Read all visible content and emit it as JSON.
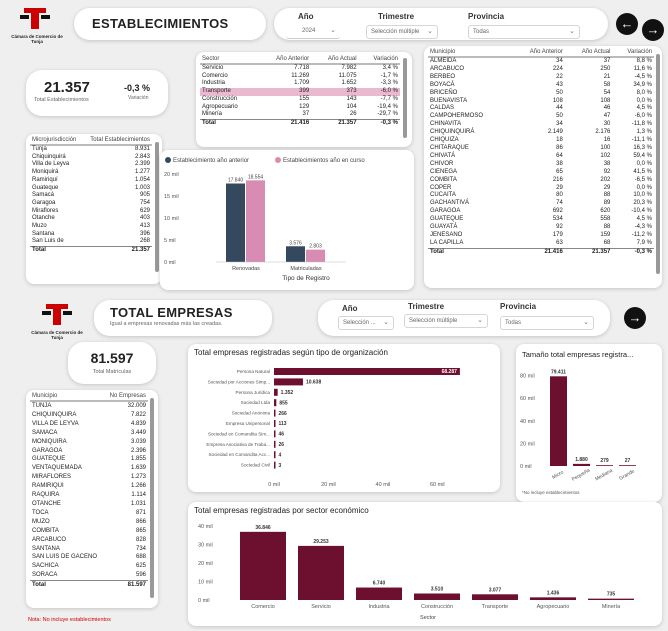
{
  "top": {
    "org_name": "Cámara de Comercio de Tunja",
    "title": "ESTABLECIMIENTOS",
    "filters": {
      "year_label": "Año",
      "year_value": "2024",
      "quarter_label": "Trimestre",
      "quarter_value": "Selección múltiple",
      "province_label": "Provincia",
      "province_value": "Todas"
    },
    "kpi": {
      "value": "21.357",
      "label": "Total Establecimientos",
      "variation": "-0,3 %",
      "variation_label": "Variación"
    },
    "sector_table": {
      "headers": [
        "Sector",
        "Año Anterior",
        "Año Actual",
        "Variación"
      ],
      "rows": [
        [
          "Servicio",
          "7.718",
          "7.982",
          "3,4 %"
        ],
        [
          "Comercio",
          "11.269",
          "11.075",
          "-1,7 %"
        ],
        [
          "Industria",
          "1.709",
          "1.652",
          "-3,3 %"
        ],
        [
          "Transporte",
          "399",
          "373",
          "-6,0 %"
        ],
        [
          "Construcción",
          "155",
          "143",
          "-7,7 %"
        ],
        [
          "Agropecuario",
          "129",
          "104",
          "-19,4 %"
        ],
        [
          "Minería",
          "37",
          "26",
          "-29,7 %"
        ]
      ],
      "total": [
        "Total",
        "21.416",
        "21.357",
        "-0,3 %"
      ]
    },
    "micro_table": {
      "headers": [
        "Microjurisdicción",
        "Total Establecimientos"
      ],
      "rows": [
        [
          "Tunja",
          "8.931"
        ],
        [
          "Chiquinquirá",
          "2.843"
        ],
        [
          "Villa de Leyva",
          "2.399"
        ],
        [
          "Moniquirá",
          "1.277"
        ],
        [
          "Ramiriquí",
          "1.054"
        ],
        [
          "Guateque",
          "1.003"
        ],
        [
          "Samacá",
          "905"
        ],
        [
          "Garagoa",
          "754"
        ],
        [
          "Miraflores",
          "629"
        ],
        [
          "Otanche",
          "403"
        ],
        [
          "Muzo",
          "413"
        ],
        [
          "Santana",
          "396"
        ],
        [
          "San Luis de",
          "268"
        ]
      ],
      "total": [
        "Total",
        "21.357"
      ]
    },
    "muni_table": {
      "headers": [
        "Municipio",
        "Año Anterior",
        "Año Actual",
        "Variación"
      ],
      "rows": [
        [
          "ALMEIDA",
          "34",
          "37",
          "8,8 %"
        ],
        [
          "ARCABUCO",
          "224",
          "250",
          "11,6 %"
        ],
        [
          "BERBEO",
          "22",
          "21",
          "-4,5 %"
        ],
        [
          "BOYACÁ",
          "43",
          "58",
          "34,9 %"
        ],
        [
          "BRICEÑO",
          "50",
          "54",
          "8,0 %"
        ],
        [
          "BUENAVISTA",
          "108",
          "108",
          "0,0 %"
        ],
        [
          "CALDAS",
          "44",
          "46",
          "4,5 %"
        ],
        [
          "CAMPOHERMOSO",
          "50",
          "47",
          "-6,0 %"
        ],
        [
          "CHINAVITA",
          "34",
          "30",
          "-11,8 %"
        ],
        [
          "CHIQUINQUIRÁ",
          "2.149",
          "2.176",
          "1,3 %"
        ],
        [
          "CHIQUIZA",
          "18",
          "16",
          "-11,1 %"
        ],
        [
          "CHITARAQUE",
          "86",
          "100",
          "16,3 %"
        ],
        [
          "CHIVATÁ",
          "64",
          "102",
          "59,4 %"
        ],
        [
          "CHIVOR",
          "38",
          "38",
          "0,0 %"
        ],
        [
          "CIENEGA",
          "65",
          "92",
          "41,5 %"
        ],
        [
          "COMBITA",
          "216",
          "202",
          "-6,5 %"
        ],
        [
          "COPER",
          "29",
          "29",
          "0,0 %"
        ],
        [
          "CUCAITA",
          "80",
          "88",
          "10,0 %"
        ],
        [
          "GACHANTIVÁ",
          "74",
          "89",
          "20,3 %"
        ],
        [
          "GARAGOA",
          "692",
          "620",
          "-10,4 %"
        ],
        [
          "GUATEQUE",
          "534",
          "558",
          "4,5 %"
        ],
        [
          "GUAYATÁ",
          "92",
          "88",
          "-4,3 %"
        ],
        [
          "JENESANO",
          "179",
          "159",
          "-11,2 %"
        ],
        [
          "LA CAPILLA",
          "63",
          "68",
          "7,9 %"
        ]
      ],
      "total": [
        "Total",
        "21.416",
        "21.357",
        "-0,3 %"
      ]
    },
    "reg_chart": {
      "legend_prev": "Establecimiento año anterior",
      "legend_curr": "Establecimientos año en curso",
      "xlabel": "Tipo de Registro",
      "color_prev": "#34495e",
      "color_curr": "#d98cb3"
    }
  },
  "chart_data": [
    {
      "type": "bar",
      "title": "",
      "xlabel": "Tipo de Registro",
      "ylabel": "",
      "categories": [
        "Renovadas",
        "Matriculadas"
      ],
      "series": [
        {
          "name": "Establecimiento año anterior",
          "values": [
            17840,
            3576
          ]
        },
        {
          "name": "Establecimientos año en curso",
          "values": [
            18554,
            2803
          ]
        }
      ],
      "yticks": [
        "0 mil",
        "5 mil",
        "10 mil",
        "15 mil",
        "20 mil"
      ],
      "ylim": [
        0,
        20000
      ]
    },
    {
      "type": "bar",
      "title": "Total empresas registradas según tipo de organización",
      "orientation": "horizontal",
      "categories": [
        "Persona Natural",
        "Sociedad por Acciones Simp...",
        "Persona Jurídica",
        "Sociedad Ltda",
        "Sociedad Anónima",
        "Empresa Unipersonal",
        "Sociedad en Comandita Sim...",
        "Empresa Asociativa de Traba...",
        "Sociedad en Comandita Acc...",
        "Sociedad Civil"
      ],
      "values": [
        68287,
        10638,
        1352,
        855,
        266,
        113,
        46,
        26,
        4,
        3
      ],
      "value_labels": [
        "68.287",
        "10.638",
        "1.352",
        "855",
        "266",
        "113",
        "46",
        "26",
        "4",
        "3"
      ],
      "xticks": [
        "0 mil",
        "20 mil",
        "40 mil",
        "60 mil"
      ],
      "xlim": [
        0,
        72000
      ]
    },
    {
      "type": "bar",
      "title": "Tamaño total empresas registra...",
      "categories": [
        "Micro",
        "Pequeña",
        "Mediana",
        "Grande"
      ],
      "values": [
        79411,
        1880,
        279,
        27
      ],
      "value_labels": [
        "79.411",
        "1.880",
        "279",
        "27"
      ],
      "yticks": [
        "0 mil",
        "20 mil",
        "40 mil",
        "60 mil",
        "80 mil"
      ],
      "ylim": [
        0,
        85000
      ],
      "note": "*No incluye establecimientos"
    },
    {
      "type": "bar",
      "title": "Total empresas registradas por sector económico",
      "xlabel": "Sector",
      "categories": [
        "Comercio",
        "Servicio",
        "Industria",
        "Construcción",
        "Transporte",
        "Agropecuario",
        "Minería"
      ],
      "values": [
        36846,
        29253,
        6740,
        3510,
        3077,
        1436,
        735
      ],
      "value_labels": [
        "36.846",
        "29.253",
        "6.740",
        "3.510",
        "3.077",
        "1.436",
        "735"
      ],
      "yticks": [
        "0 mil",
        "10 mil",
        "20 mil",
        "30 mil",
        "40 mil"
      ],
      "ylim": [
        0,
        40000
      ]
    }
  ],
  "bottom": {
    "org_name": "Cámara de Comercio de Tunja",
    "title": "TOTAL EMPRESAS",
    "subtitle": "Igual a empresas renovadas más las creadas.",
    "filters": {
      "year_label": "Año",
      "year_value": "Selección ...",
      "quarter_label": "Trimestre",
      "quarter_value": "Selección múltiple",
      "province_label": "Provincia",
      "province_value": "Todas"
    },
    "kpi": {
      "value": "81.597",
      "label": "Total Matrículas"
    },
    "muni_table": {
      "headers": [
        "Municipio",
        "No Empresas"
      ],
      "rows": [
        [
          "TUNJA",
          "32.009"
        ],
        [
          "CHIQUINQUIRA",
          "7.822"
        ],
        [
          "VILLA DE LEYVA",
          "4.839"
        ],
        [
          "SAMACA",
          "3.449"
        ],
        [
          "MONIQUIRA",
          "3.039"
        ],
        [
          "GARAGOA",
          "2.396"
        ],
        [
          "GUATEQUE",
          "1.855"
        ],
        [
          "VENTAQUEMADA",
          "1.639"
        ],
        [
          "MIRAFLORES",
          "1.273"
        ],
        [
          "RAMIRIQUI",
          "1.266"
        ],
        [
          "RAQUIRA",
          "1.114"
        ],
        [
          "OTANCHE",
          "1.031"
        ],
        [
          "TOCA",
          "871"
        ],
        [
          "MUZO",
          "866"
        ],
        [
          "COMBITA",
          "865"
        ],
        [
          "ARCABUCO",
          "828"
        ],
        [
          "SANTANA",
          "734"
        ],
        [
          "SAN LUIS DE GACENO",
          "688"
        ],
        [
          "SACHICA",
          "625"
        ],
        [
          "SORACA",
          "596"
        ]
      ],
      "total": [
        "Total",
        "81.597"
      ]
    },
    "note": "Nota: No incluye establecimientos",
    "color": "#6d0f2e"
  }
}
